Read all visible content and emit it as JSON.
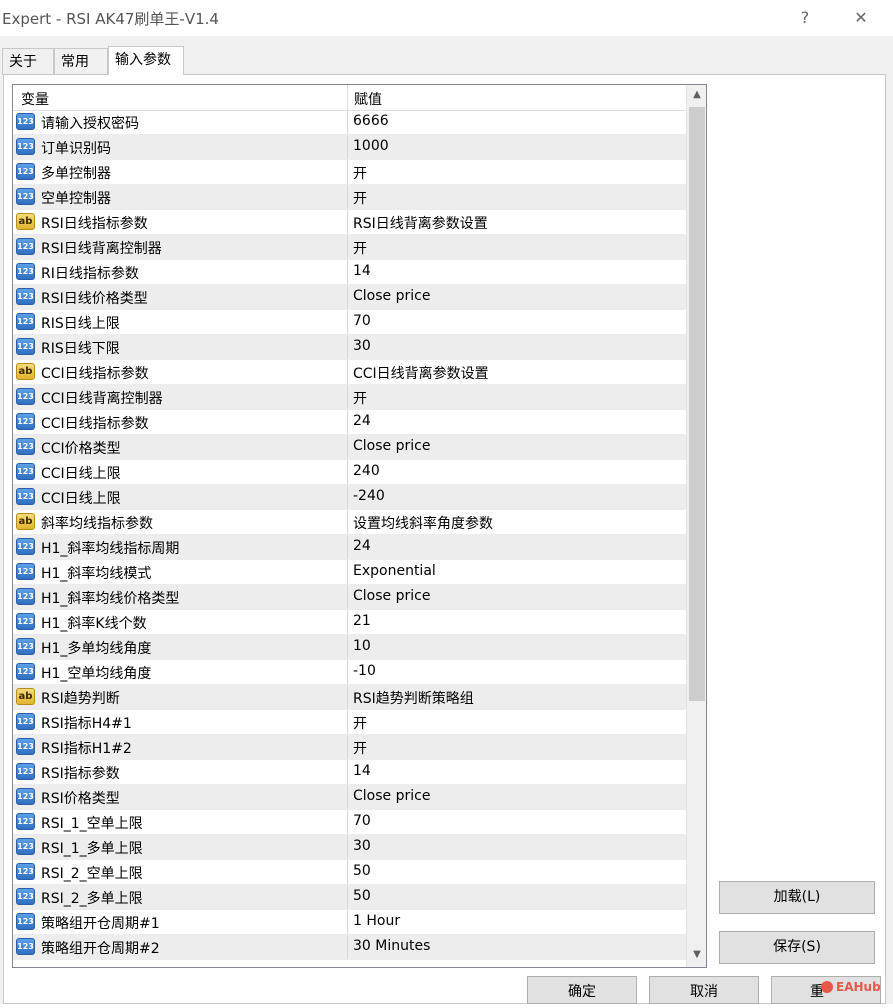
{
  "window": {
    "title": "Expert - RSI AK47刷单王-V1.4",
    "help": "?",
    "close": "✕"
  },
  "tabs": [
    {
      "label": "关于"
    },
    {
      "label": "常用"
    },
    {
      "label": "输入参数",
      "active": true
    }
  ],
  "grid": {
    "header": {
      "name": "变量",
      "value": "赋值"
    },
    "rows": [
      {
        "icon": "num",
        "name": "请输入授权密码",
        "value": "6666"
      },
      {
        "icon": "num",
        "name": "订单识别码",
        "value": "1000"
      },
      {
        "icon": "num",
        "name": "多单控制器",
        "value": "开"
      },
      {
        "icon": "num",
        "name": "空单控制器",
        "value": "开"
      },
      {
        "icon": "str",
        "name": "RSI日线指标参数",
        "value": "RSI日线背离参数设置"
      },
      {
        "icon": "num",
        "name": "RSI日线背离控制器",
        "value": "开"
      },
      {
        "icon": "num",
        "name": "RI日线指标参数",
        "value": "14"
      },
      {
        "icon": "num",
        "name": "RSI日线价格类型",
        "value": "Close price"
      },
      {
        "icon": "num",
        "name": "RIS日线上限",
        "value": "70"
      },
      {
        "icon": "num",
        "name": "RIS日线下限",
        "value": "30"
      },
      {
        "icon": "str",
        "name": "CCI日线指标参数",
        "value": "CCI日线背离参数设置"
      },
      {
        "icon": "num",
        "name": "CCI日线背离控制器",
        "value": "开"
      },
      {
        "icon": "num",
        "name": "CCI日线指标参数",
        "value": "24"
      },
      {
        "icon": "num",
        "name": "CCI价格类型",
        "value": "Close price"
      },
      {
        "icon": "num",
        "name": "CCI日线上限",
        "value": "240"
      },
      {
        "icon": "num",
        "name": "CCI日线上限",
        "value": "-240"
      },
      {
        "icon": "str",
        "name": "斜率均线指标参数",
        "value": "设置均线斜率角度参数"
      },
      {
        "icon": "num",
        "name": "H1_斜率均线指标周期",
        "value": "24"
      },
      {
        "icon": "num",
        "name": "H1_斜率均线模式",
        "value": "Exponential"
      },
      {
        "icon": "num",
        "name": "H1_斜率均线价格类型",
        "value": "Close price"
      },
      {
        "icon": "num",
        "name": "H1_斜率K线个数",
        "value": "21"
      },
      {
        "icon": "num",
        "name": "H1_多单均线角度",
        "value": "10"
      },
      {
        "icon": "num",
        "name": "H1_空单均线角度",
        "value": "-10"
      },
      {
        "icon": "str",
        "name": "RSI趋势判断",
        "value": "RSI趋势判断策略组"
      },
      {
        "icon": "num",
        "name": "RSI指标H4#1",
        "value": "开"
      },
      {
        "icon": "num",
        "name": "RSI指标H1#2",
        "value": "开"
      },
      {
        "icon": "num",
        "name": "RSI指标参数",
        "value": "14"
      },
      {
        "icon": "num",
        "name": "RSI价格类型",
        "value": "Close price"
      },
      {
        "icon": "num",
        "name": "RSI_1_空单上限",
        "value": "70"
      },
      {
        "icon": "num",
        "name": "RSI_1_多单上限",
        "value": "30"
      },
      {
        "icon": "num",
        "name": "RSI_2_空单上限",
        "value": "50"
      },
      {
        "icon": "num",
        "name": "RSI_2_多单上限",
        "value": "50"
      },
      {
        "icon": "num",
        "name": "策略组开仓周期#1",
        "value": "1 Hour"
      },
      {
        "icon": "num",
        "name": "策略组开仓周期#2",
        "value": "30 Minutes"
      }
    ]
  },
  "icons": {
    "num": "123",
    "str": "ab"
  },
  "scrollbar": {
    "up": "▲",
    "down": "▼"
  },
  "side_buttons": {
    "load": "加载(L)",
    "save": "保存(S)"
  },
  "footer_buttons": {
    "ok": "确定",
    "cancel": "取消",
    "reset": "重"
  },
  "watermark": "EAHub"
}
